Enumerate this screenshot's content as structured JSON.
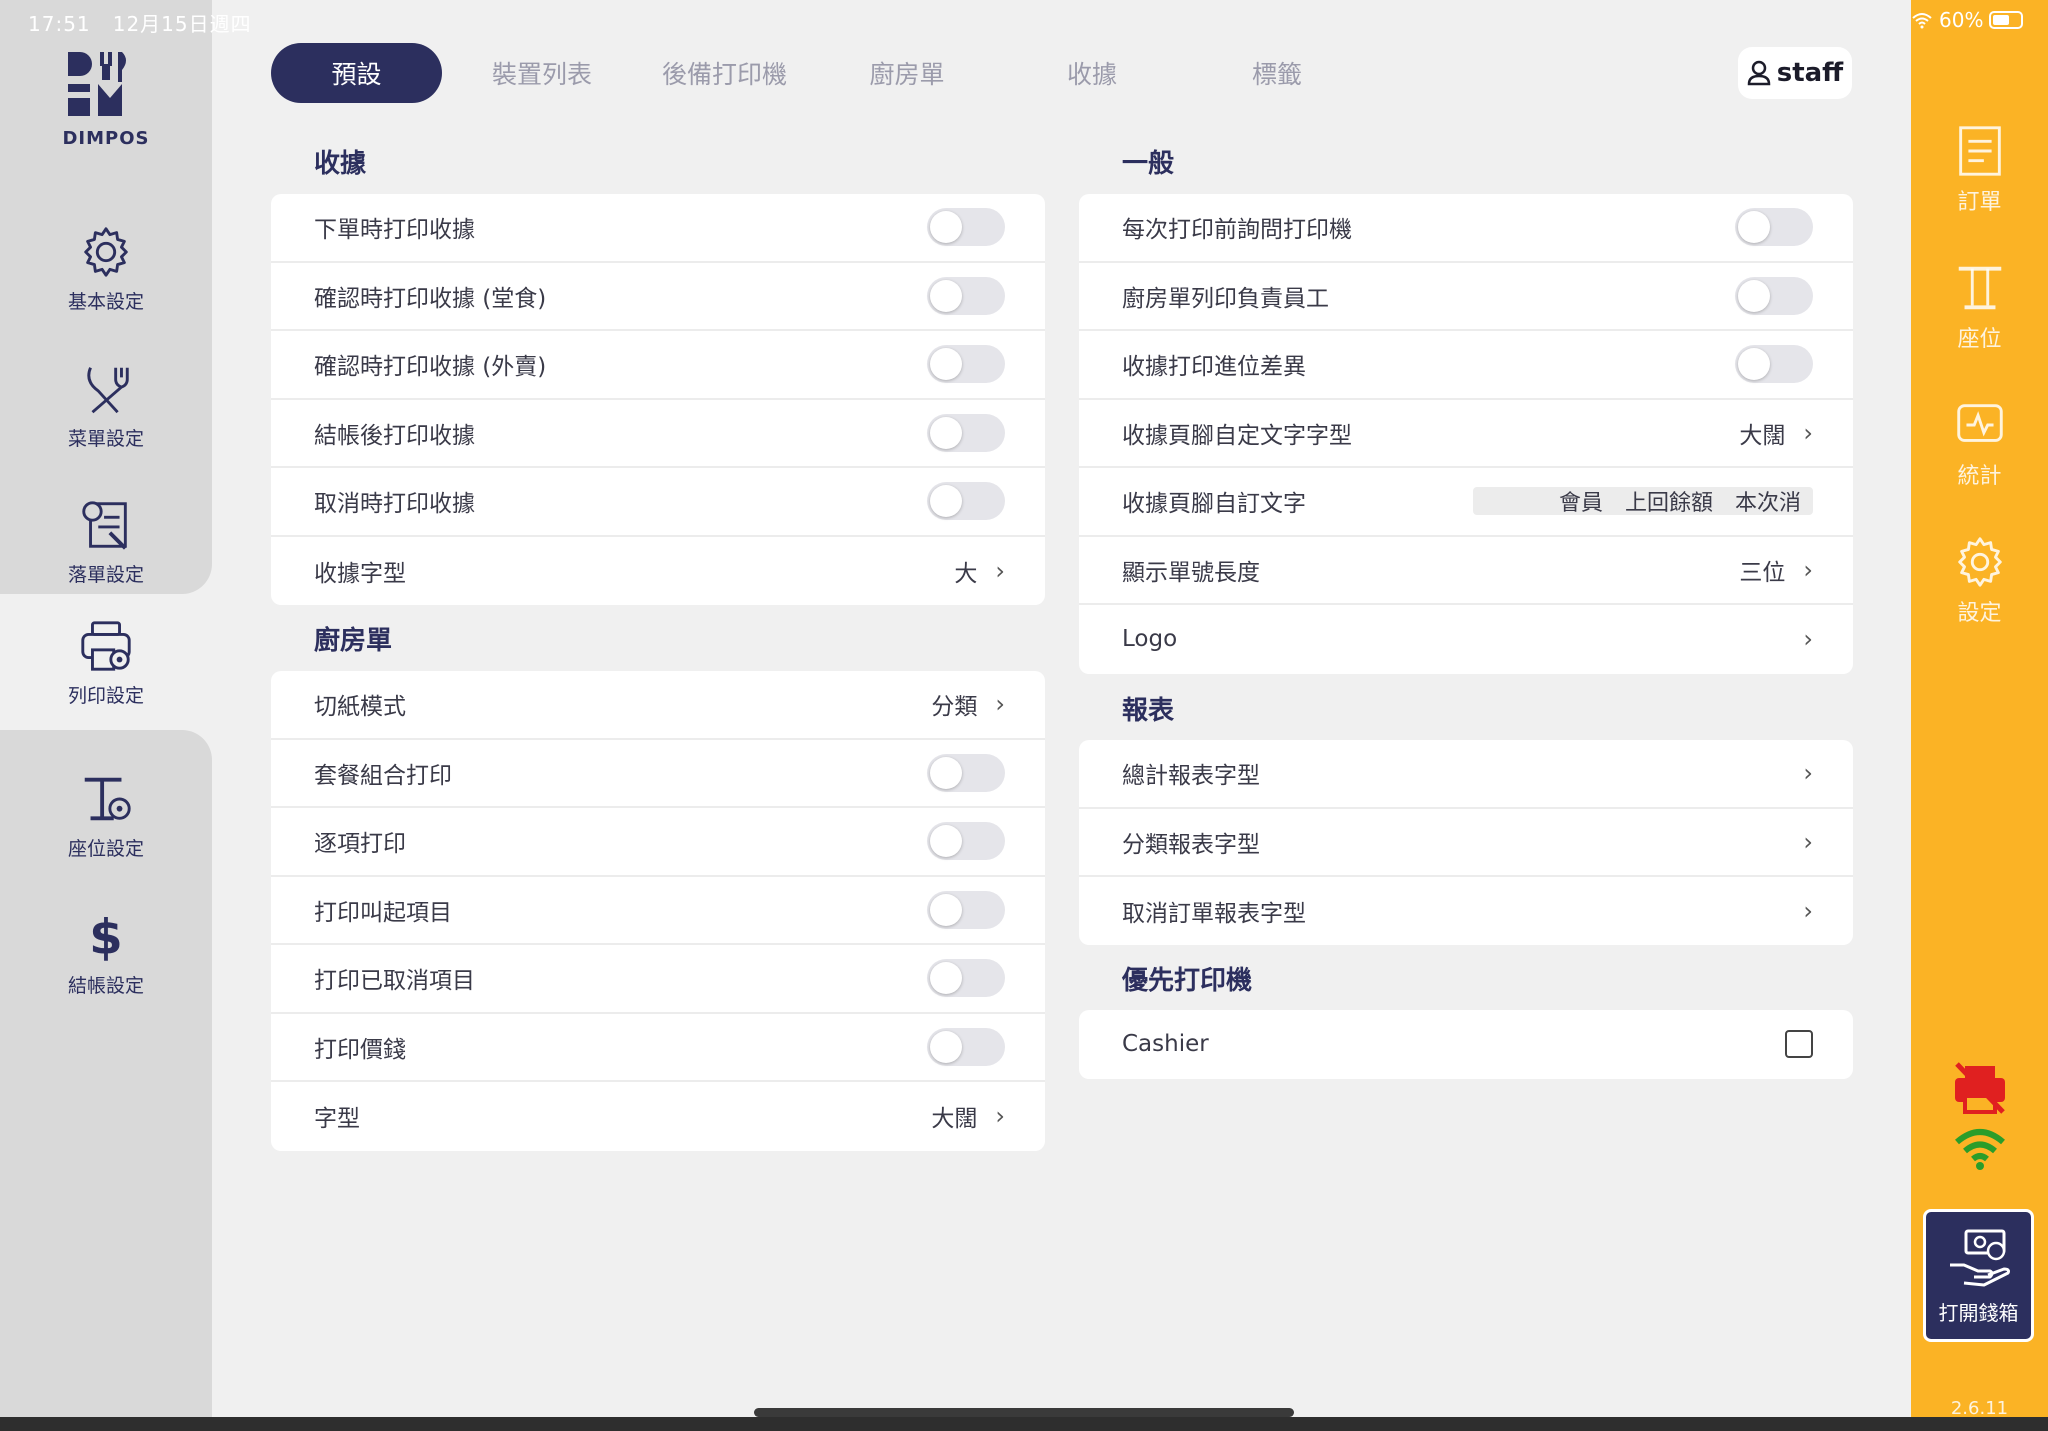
{
  "status": {
    "time": "17:51",
    "date": "12月15日週四",
    "battery": "60%"
  },
  "brand": {
    "name": "DIMPOS"
  },
  "left_nav": [
    {
      "label": "基本設定",
      "icon": "gear-icon"
    },
    {
      "label": "菜單設定",
      "icon": "fork-knife-icon"
    },
    {
      "label": "落單設定",
      "icon": "order-settings-icon"
    },
    {
      "label": "列印設定",
      "icon": "printer-settings-icon",
      "active": true
    },
    {
      "label": "座位設定",
      "icon": "table-settings-icon"
    },
    {
      "label": "結帳設定",
      "icon": "dollar-icon"
    }
  ],
  "tabs": [
    "預設",
    "裝置列表",
    "後備打印機",
    "廚房單",
    "收據",
    "標籤"
  ],
  "active_tab": "預設",
  "user": {
    "name": "staff"
  },
  "left_column": {
    "receipt": {
      "title": "收據",
      "rows": [
        {
          "label": "下單時打印收據",
          "type": "toggle",
          "on": false
        },
        {
          "label": "確認時打印收據 (堂食)",
          "type": "toggle",
          "on": false
        },
        {
          "label": "確認時打印收據 (外賣)",
          "type": "toggle",
          "on": false
        },
        {
          "label": "結帳後打印收據",
          "type": "toggle",
          "on": false
        },
        {
          "label": "取消時打印收據",
          "type": "toggle",
          "on": false
        },
        {
          "label": "收據字型",
          "type": "select",
          "value": "大"
        }
      ]
    },
    "kitchen": {
      "title": "廚房單",
      "rows": [
        {
          "label": "切紙模式",
          "type": "select",
          "value": "分類"
        },
        {
          "label": "套餐組合打印",
          "type": "toggle",
          "on": false
        },
        {
          "label": "逐項打印",
          "type": "toggle",
          "on": false
        },
        {
          "label": "打印叫起項目",
          "type": "toggle",
          "on": false
        },
        {
          "label": "打印已取消項目",
          "type": "toggle",
          "on": false
        },
        {
          "label": "打印價錢",
          "type": "toggle",
          "on": false
        },
        {
          "label": "字型",
          "type": "select",
          "value": "大闊"
        }
      ]
    }
  },
  "right_column": {
    "general": {
      "title": "一般",
      "rows": [
        {
          "label": "每次打印前詢問打印機",
          "type": "toggle",
          "on": false
        },
        {
          "label": "廚房單列印負責員工",
          "type": "toggle",
          "on": false
        },
        {
          "label": "收據打印進位差異",
          "type": "toggle",
          "on": false
        },
        {
          "label": "收據頁腳自定文字字型",
          "type": "select",
          "value": "大闊"
        },
        {
          "label": "收據頁腳自訂文字",
          "type": "field",
          "values": [
            "會員",
            "上回餘額",
            "本次消"
          ]
        },
        {
          "label": "顯示單號長度",
          "type": "select",
          "value": "三位"
        },
        {
          "label": "Logo",
          "type": "select",
          "value": ""
        }
      ]
    },
    "reports": {
      "title": "報表",
      "rows": [
        {
          "label": "總計報表字型",
          "type": "select",
          "value": ""
        },
        {
          "label": "分類報表字型",
          "type": "select",
          "value": ""
        },
        {
          "label": "取消訂單報表字型",
          "type": "select",
          "value": ""
        }
      ]
    },
    "priority": {
      "title": "優先打印機",
      "rows": [
        {
          "label": "Cashier",
          "type": "checkbox",
          "checked": false
        }
      ]
    }
  },
  "right_nav": [
    {
      "label": "訂單",
      "icon": "order-list-icon"
    },
    {
      "label": "座位",
      "icon": "table-icon"
    },
    {
      "label": "統計",
      "icon": "stats-icon"
    },
    {
      "label": "設定",
      "icon": "settings-gear-icon"
    }
  ],
  "status_icons": [
    "printer-offline-icon",
    "wifi-icon"
  ],
  "cash_drawer": {
    "label": "打開錢箱",
    "icon": "cash-drawer-icon"
  },
  "version": "2.6.11",
  "colors": {
    "brand": "#2c2f5e",
    "accent": "#fbb325",
    "printer_offline": "#e02020",
    "wifi": "#2a9d2a"
  }
}
